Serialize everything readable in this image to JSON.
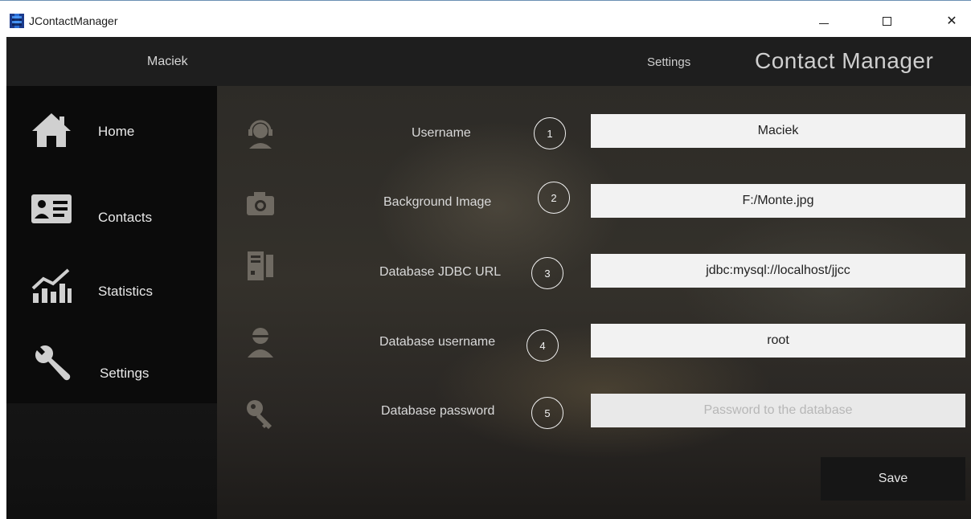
{
  "window": {
    "title": "JContactManager",
    "minimize_glyph": "—",
    "maximize_glyph": "□",
    "close_glyph": "✕"
  },
  "header": {
    "user_name": "Maciek",
    "settings_label": "Settings",
    "app_title": "Contact Manager"
  },
  "sidebar": {
    "items": [
      {
        "label": "Home",
        "icon": "home-icon"
      },
      {
        "label": "Contacts",
        "icon": "contact-card-icon"
      },
      {
        "label": "Statistics",
        "icon": "statistics-icon"
      },
      {
        "label": "Settings",
        "icon": "wrench-icon"
      }
    ]
  },
  "settings_form": {
    "rows": [
      {
        "label": "Username",
        "number": "1",
        "value": "Maciek",
        "placeholder": "",
        "icon": "user-headset-icon"
      },
      {
        "label": "Background Image",
        "number": "2",
        "value": "F:/Monte.jpg",
        "placeholder": "",
        "icon": "camera-icon"
      },
      {
        "label": "Database JDBC URL",
        "number": "3",
        "value": "jdbc:mysql://localhost/jjcc",
        "placeholder": "",
        "icon": "server-icon"
      },
      {
        "label": "Database username",
        "number": "4",
        "value": "root",
        "placeholder": "",
        "icon": "user-icon"
      },
      {
        "label": "Database password",
        "number": "5",
        "value": "",
        "placeholder": "Password to the database",
        "icon": "key-icon"
      }
    ],
    "save_label": "Save"
  }
}
